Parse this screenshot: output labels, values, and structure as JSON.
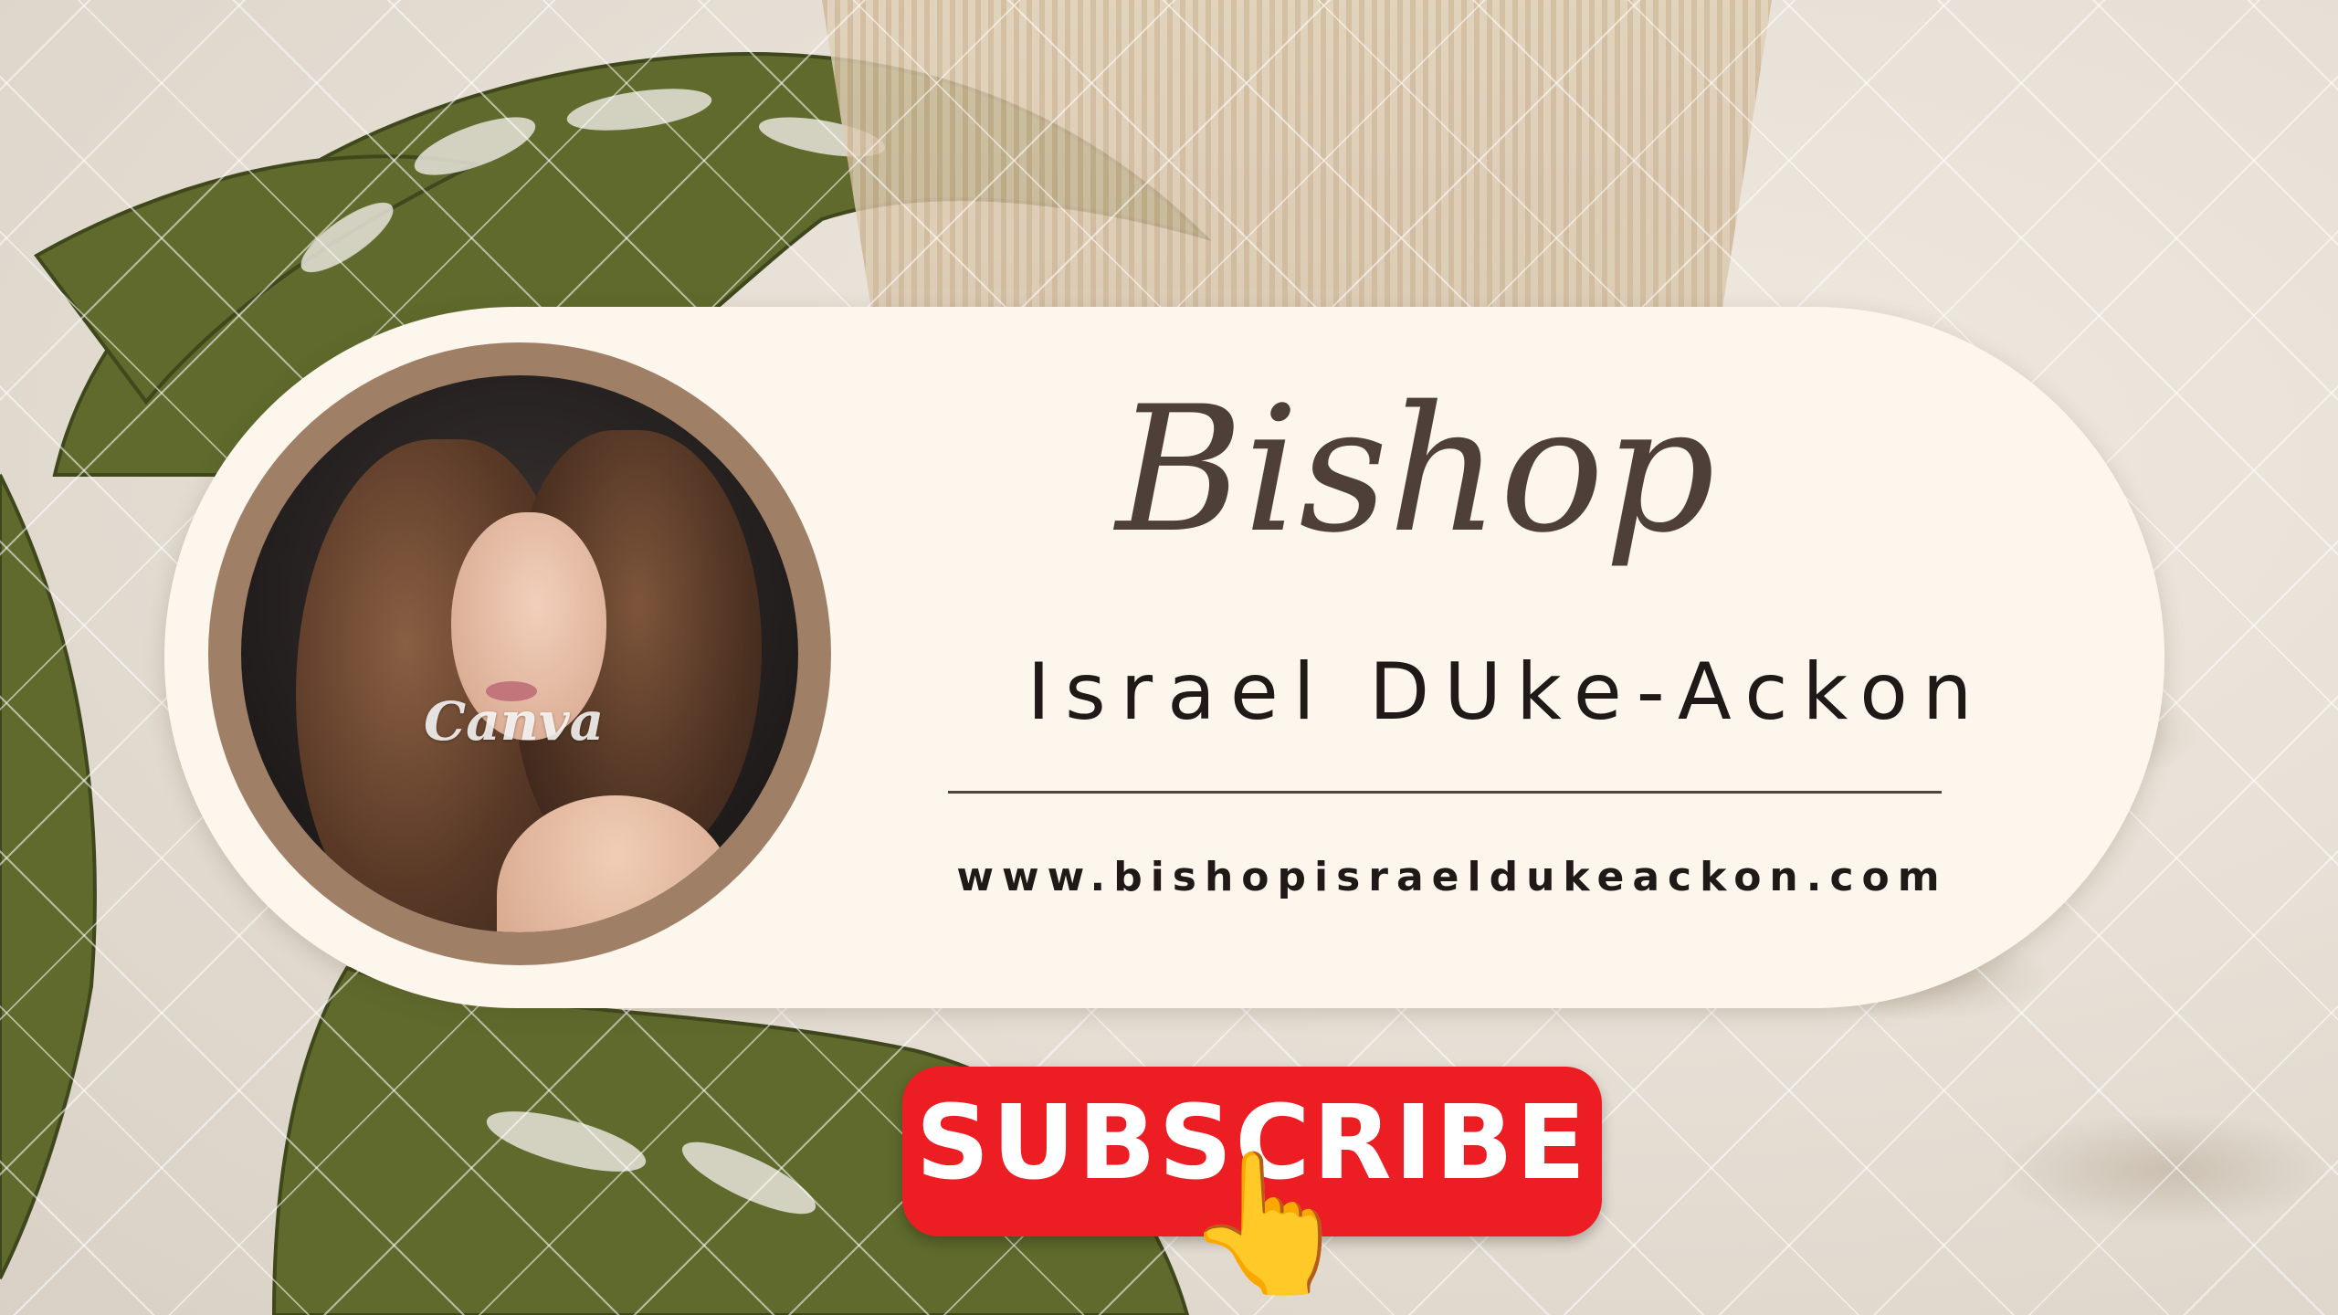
{
  "card": {
    "title": "Bishop",
    "name": "Israel DUke-Ackon",
    "url": "www.bishopisraeldukeackon.com"
  },
  "avatar": {
    "watermark": "Canva"
  },
  "cta": {
    "subscribe_label": "SUBSCRIBE",
    "pointer_glyph": "👆"
  },
  "colors": {
    "subscribe_red": "#ed1d24",
    "card_bg": "#fcf6ec",
    "ring": "#a07f67",
    "title_text": "#4e4039"
  }
}
